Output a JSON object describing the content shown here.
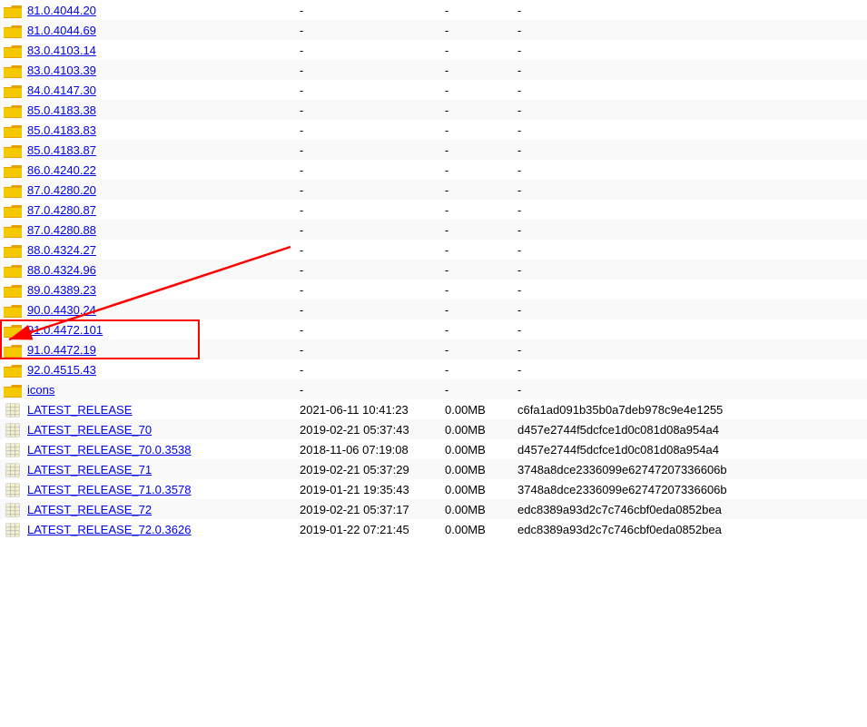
{
  "rows": [
    {
      "type": "folder",
      "name": "81.0.4044.20",
      "date": "-",
      "size": "-",
      "hash": "-",
      "highlighted": false
    },
    {
      "type": "folder",
      "name": "81.0.4044.69",
      "date": "-",
      "size": "-",
      "hash": "-",
      "highlighted": false
    },
    {
      "type": "folder",
      "name": "83.0.4103.14",
      "date": "-",
      "size": "-",
      "hash": "-",
      "highlighted": false
    },
    {
      "type": "folder",
      "name": "83.0.4103.39",
      "date": "-",
      "size": "-",
      "hash": "-",
      "highlighted": false
    },
    {
      "type": "folder",
      "name": "84.0.4147.30",
      "date": "-",
      "size": "-",
      "hash": "-",
      "highlighted": false
    },
    {
      "type": "folder",
      "name": "85.0.4183.38",
      "date": "-",
      "size": "-",
      "hash": "-",
      "highlighted": false
    },
    {
      "type": "folder",
      "name": "85.0.4183.83",
      "date": "-",
      "size": "-",
      "hash": "-",
      "highlighted": false
    },
    {
      "type": "folder",
      "name": "85.0.4183.87",
      "date": "-",
      "size": "-",
      "hash": "-",
      "highlighted": false
    },
    {
      "type": "folder",
      "name": "86.0.4240.22",
      "date": "-",
      "size": "-",
      "hash": "-",
      "highlighted": false
    },
    {
      "type": "folder",
      "name": "87.0.4280.20",
      "date": "-",
      "size": "-",
      "hash": "-",
      "highlighted": false
    },
    {
      "type": "folder",
      "name": "87.0.4280.87",
      "date": "-",
      "size": "-",
      "hash": "-",
      "highlighted": false
    },
    {
      "type": "folder",
      "name": "87.0.4280.88",
      "date": "-",
      "size": "-",
      "hash": "-",
      "highlighted": false
    },
    {
      "type": "folder",
      "name": "88.0.4324.27",
      "date": "-",
      "size": "-",
      "hash": "-",
      "highlighted": false
    },
    {
      "type": "folder",
      "name": "88.0.4324.96",
      "date": "-",
      "size": "-",
      "hash": "-",
      "highlighted": false
    },
    {
      "type": "folder",
      "name": "89.0.4389.23",
      "date": "-",
      "size": "-",
      "hash": "-",
      "highlighted": false
    },
    {
      "type": "folder",
      "name": "90.0.4430.24",
      "date": "-",
      "size": "-",
      "hash": "-",
      "highlighted": false
    },
    {
      "type": "folder",
      "name": "91.0.4472.101",
      "date": "-",
      "size": "-",
      "hash": "-",
      "highlighted": true
    },
    {
      "type": "folder",
      "name": "91.0.4472.19",
      "date": "-",
      "size": "-",
      "hash": "-",
      "highlighted": true
    },
    {
      "type": "folder",
      "name": "92.0.4515.43",
      "date": "-",
      "size": "-",
      "hash": "-",
      "highlighted": false
    },
    {
      "type": "folder",
      "name": "icons",
      "date": "-",
      "size": "-",
      "hash": "-",
      "highlighted": false
    },
    {
      "type": "file",
      "name": "LATEST_RELEASE",
      "date": "2021-06-11 10:41:23",
      "size": "0.00MB",
      "hash": "c6fa1ad091b35b0a7deb978c9e4e1255",
      "highlighted": false
    },
    {
      "type": "file",
      "name": "LATEST_RELEASE_70",
      "date": "2019-02-21 05:37:43",
      "size": "0.00MB",
      "hash": "d457e2744f5dcfce1d0c081d08a954a4",
      "highlighted": false
    },
    {
      "type": "file",
      "name": "LATEST_RELEASE_70.0.3538",
      "date": "2018-11-06 07:19:08",
      "size": "0.00MB",
      "hash": "d457e2744f5dcfce1d0c081d08a954a4",
      "highlighted": false
    },
    {
      "type": "file",
      "name": "LATEST_RELEASE_71",
      "date": "2019-02-21 05:37:29",
      "size": "0.00MB",
      "hash": "3748a8dce2336099e62747207336606b",
      "highlighted": false
    },
    {
      "type": "file",
      "name": "LATEST_RELEASE_71.0.3578",
      "date": "2019-01-21 19:35:43",
      "size": "0.00MB",
      "hash": "3748a8dce2336099e62747207336606b",
      "highlighted": false
    },
    {
      "type": "file",
      "name": "LATEST_RELEASE_72",
      "date": "2019-02-21 05:37:17",
      "size": "0.00MB",
      "hash": "edc8389a93d2c7c746cbf0eda0852bea",
      "highlighted": false
    },
    {
      "type": "file",
      "name": "LATEST_RELEASE_72.0.3626",
      "date": "2019-01-22 07:21:45",
      "size": "0.00MB",
      "hash": "edc8389a93d2c7c746cbf0eda0852bea",
      "highlighted": false
    }
  ],
  "arrow": {
    "visible": true,
    "target": "91.0.4472.101"
  }
}
